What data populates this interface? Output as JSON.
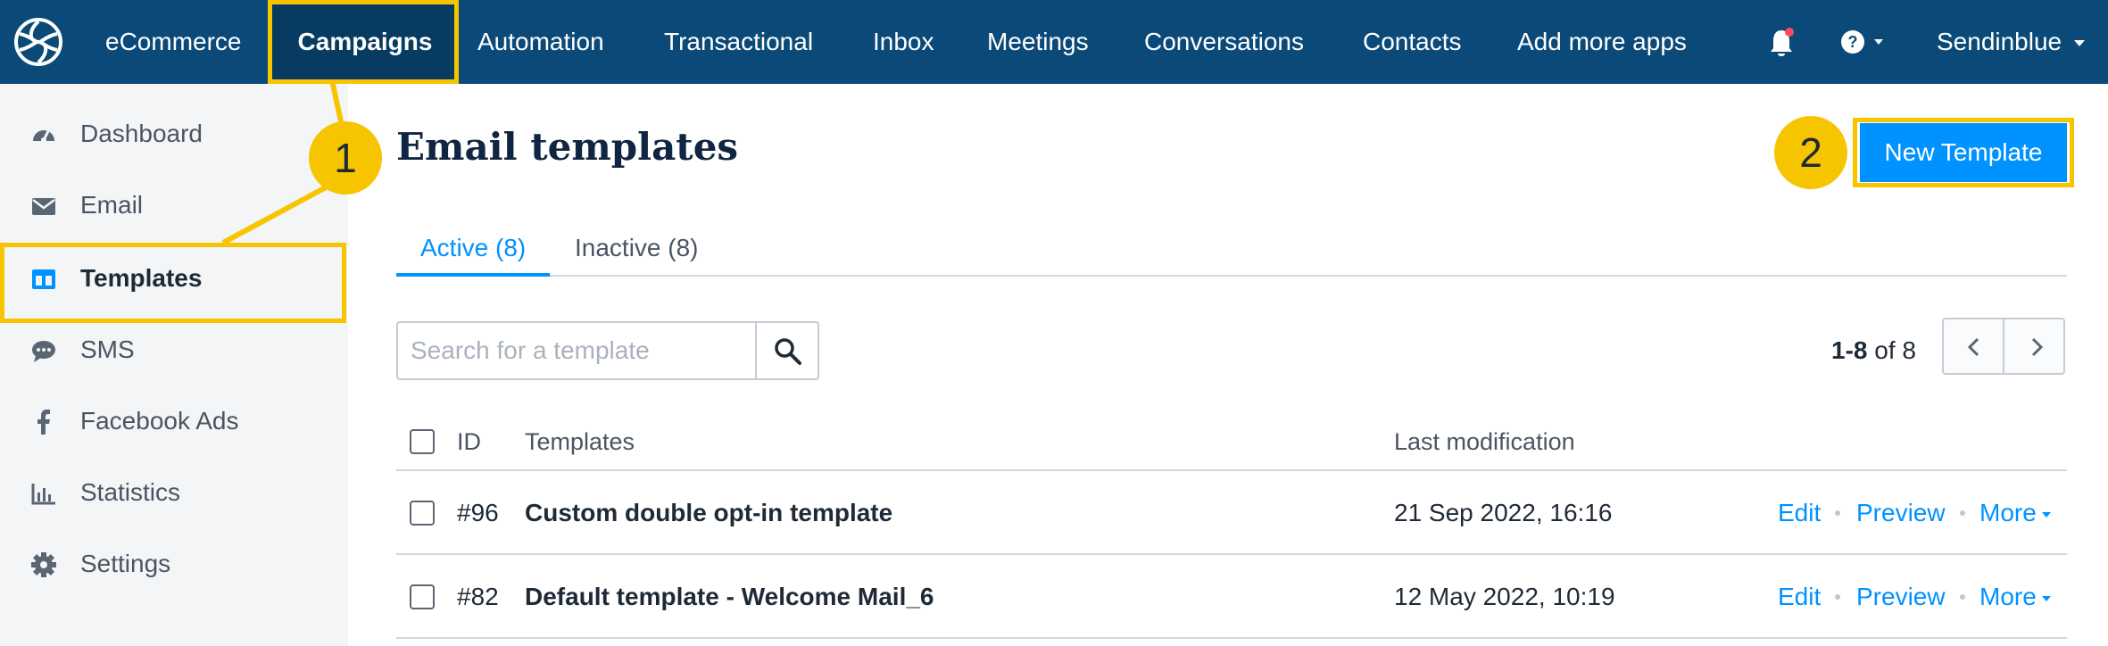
{
  "topnav": {
    "items": [
      {
        "label": "eCommerce"
      },
      {
        "label": "Campaigns"
      },
      {
        "label": "Automation"
      },
      {
        "label": "Transactional"
      },
      {
        "label": "Inbox"
      },
      {
        "label": "Meetings"
      },
      {
        "label": "Conversations"
      },
      {
        "label": "Contacts"
      },
      {
        "label": "Add more apps"
      }
    ],
    "active_item": "Campaigns",
    "account": "Sendinblue",
    "icons": [
      "sendinblue-logo-icon",
      "bell-icon",
      "help-icon"
    ]
  },
  "sidebar": {
    "items": [
      {
        "label": "Dashboard",
        "icon": "gauge-icon"
      },
      {
        "label": "Email",
        "icon": "envelope-icon"
      },
      {
        "label": "Templates",
        "icon": "template-icon"
      },
      {
        "label": "SMS",
        "icon": "chat-bubble-icon"
      },
      {
        "label": "Facebook Ads",
        "icon": "facebook-icon"
      },
      {
        "label": "Statistics",
        "icon": "bar-chart-icon"
      },
      {
        "label": "Settings",
        "icon": "gear-icon"
      }
    ],
    "active_item": "Templates"
  },
  "callouts": {
    "one": "1",
    "two": "2"
  },
  "main": {
    "title": "Email templates",
    "new_button": "New Template",
    "tabs": [
      {
        "label": "Active (8)"
      },
      {
        "label": "Inactive (8)"
      }
    ],
    "search": {
      "placeholder": "Search for a template"
    },
    "pager": {
      "range": "1-8",
      "of_label": "of",
      "total": "8"
    }
  },
  "table": {
    "headers": {
      "id": "ID",
      "templates": "Templates",
      "last_modification": "Last modification"
    },
    "rows": [
      {
        "id": "#96",
        "name": "Custom double opt-in template",
        "modified": "21 Sep 2022, 16:16"
      },
      {
        "id": "#82",
        "name": "Default template - Welcome Mail_6",
        "modified": "12 May 2022, 10:19"
      }
    ],
    "actions": {
      "edit": "Edit",
      "preview": "Preview",
      "more": "More"
    }
  },
  "colors": {
    "nav_bg": "#0b4a78",
    "accent": "#0092ff",
    "highlight": "#f7c500"
  }
}
